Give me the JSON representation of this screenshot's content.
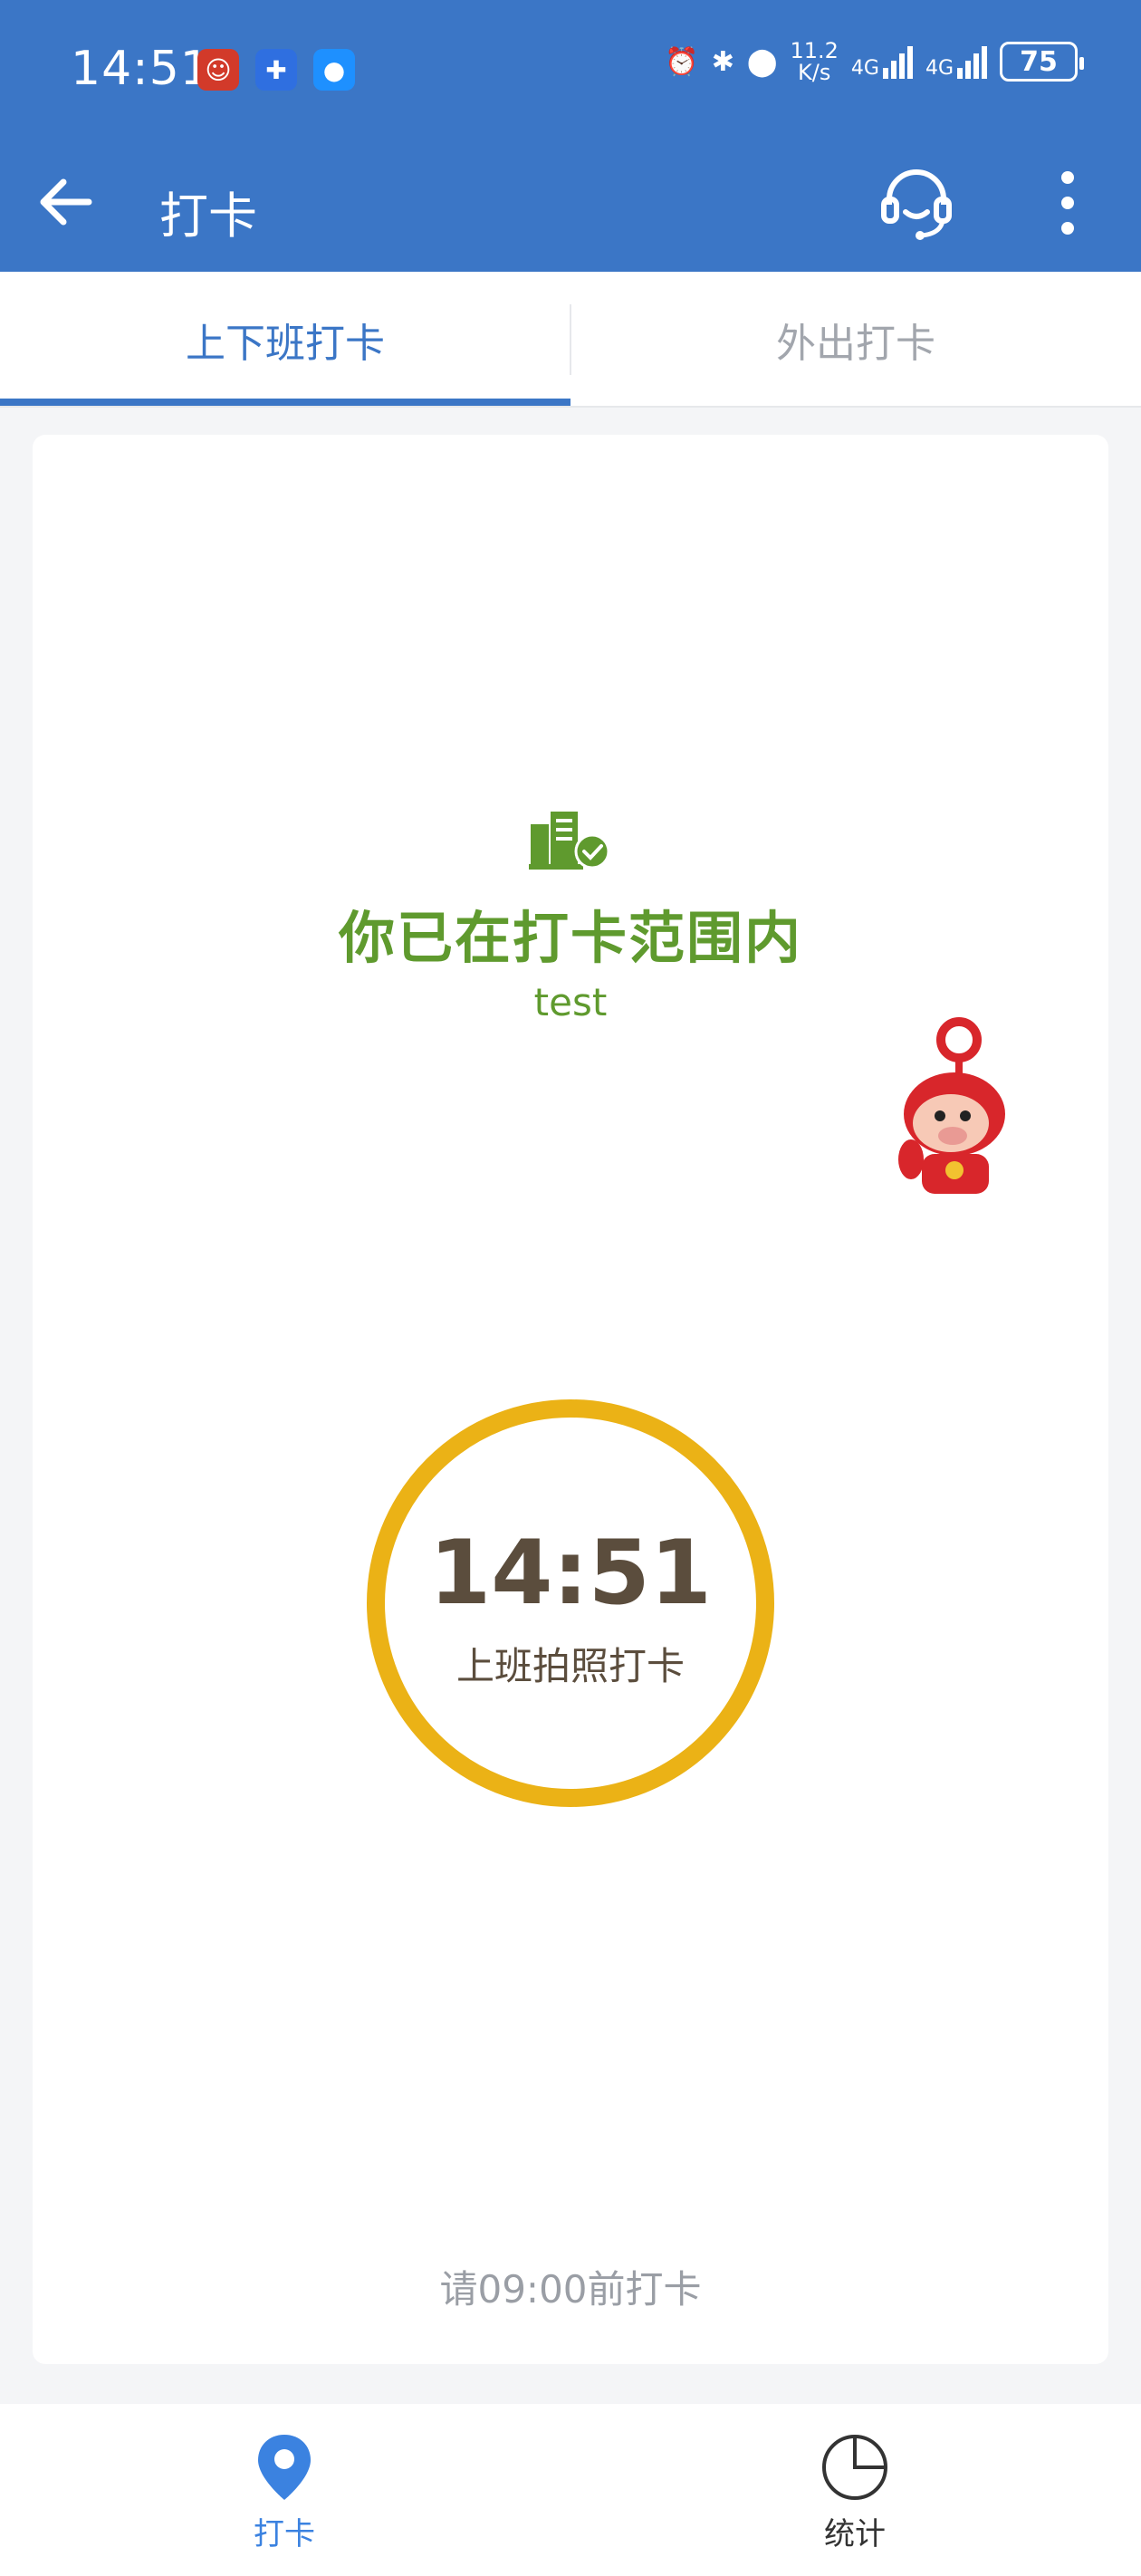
{
  "status_bar": {
    "time": "14:51",
    "net_speed_value": "11.2",
    "net_speed_unit": "K/s",
    "network1": "4G",
    "network2": "4G",
    "battery": "75"
  },
  "app_bar": {
    "title": "打卡",
    "back_icon": "arrow-left-icon",
    "service_icon": "headset-icon",
    "more_icon": "more-vertical-icon"
  },
  "tabs": [
    {
      "label": "上下班打卡",
      "active": true
    },
    {
      "label": "外出打卡",
      "active": false
    }
  ],
  "main": {
    "range_status": "你已在打卡范围内",
    "location_name": "test",
    "clock_time": "14:51",
    "clock_action": "上班拍照打卡",
    "deadline_hint": "请09:00前打卡"
  },
  "bottom_nav": [
    {
      "label": "打卡",
      "icon": "location-pin-icon",
      "active": true
    },
    {
      "label": "统计",
      "icon": "pie-chart-icon",
      "active": false
    }
  ],
  "colors": {
    "primary": "#3b76c6",
    "success": "#5f9a2e",
    "ring": "#ebb216",
    "clock_text": "#5b4d3d"
  }
}
